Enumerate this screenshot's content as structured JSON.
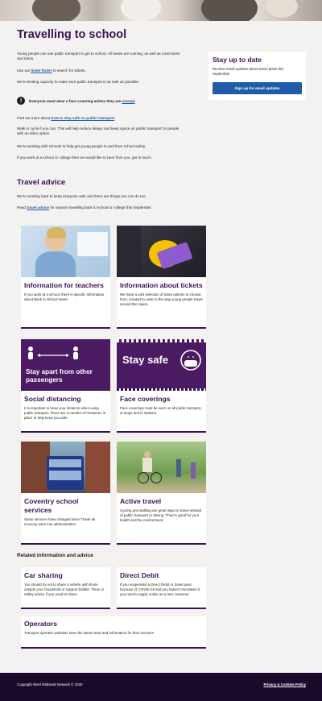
{
  "page": {
    "title": "Travelling to school"
  },
  "intro": {
    "p1": "Young people can use public transport to get to school. All buses are running, as well as most trams and trains.",
    "p2_prefix": "Use our ",
    "p2_link": "ticket finder",
    "p2_suffix": " to search for tickets.",
    "p3": "We're limiting capacity to make sure public transport is as safe as possible.",
    "notice_prefix": "Everyone must wear a face covering unless they are ",
    "notice_link": "exempt",
    "p4_prefix": "Find out more about ",
    "p4_link": "how to stay safe on public transport",
    "p4_suffix": ".",
    "p5": "Walk or cycle if you can. This will help reduce delays and keep space on public transport for people with no other option.",
    "p6": "We're working with schools to help get young people to and from school safely.",
    "p7": "If you work at a school or college then we would like to hear from you, get in touch."
  },
  "sidebar": {
    "title": "Stay up to date",
    "text": "Receive email updates about travel plans this September",
    "button": "Sign up for email updates"
  },
  "travel_advice": {
    "heading": "Travel advice",
    "p1": "We're working hard to keep everyone safe and there are things you can do too.",
    "p2_prefix": "Read ",
    "p2_link": "travel advice",
    "p2_suffix": " for anyone travelling back to school or college this September."
  },
  "cards": [
    {
      "title": "Information for teachers",
      "text": "If you work at a school, there is specific information about Back to School travel."
    },
    {
      "title": "Information about tickets",
      "text": "We have a vast selection of ticket options to choose from, created to cater to the way young people travel around the region."
    },
    {
      "title": "Social distancing",
      "text": "It is important to keep your distance when using public transport. There are a number of measures in place to help keep you safe.",
      "banner": "Stay apart from other passengers"
    },
    {
      "title": "Face coverings",
      "text": "Face coverings must be worn on all public transport, at stops and in stations.",
      "banner": "Stay safe"
    },
    {
      "title": "Coventry school services",
      "text": "Some services have changed since Travel de Courcey were into administration."
    },
    {
      "title": "Active travel",
      "text": "Cycling and walking are great ways to travel instead of public transport or driving. They're good for your health and the environment."
    }
  ],
  "related": {
    "heading": "Related information and advice",
    "cards": [
      {
        "title": "Car sharing",
        "text": "You should try not to share a vehicle with those outside your household or support bubble. There is safety advice if you need to share."
      },
      {
        "title": "Direct Debit",
        "text": "If you suspended a Direct Debit or travel pass because of COVID-19 and you haven't reinstated it, you need to apply online as a new customer."
      },
      {
        "title": "Operators",
        "text": "Transport operator websites have the latest news and information for their services."
      }
    ]
  },
  "footer": {
    "copyright": "Copyright West Midlands Network © 2020",
    "policy": "Privacy & Cookies Policy"
  },
  "colors": {
    "brand": "#3c1053",
    "link": "#1e5ca8",
    "footer": "#1a0a2c"
  },
  "icons": [
    "warning-icon",
    "person-icon",
    "double-arrow-icon",
    "face-mask-icon"
  ]
}
